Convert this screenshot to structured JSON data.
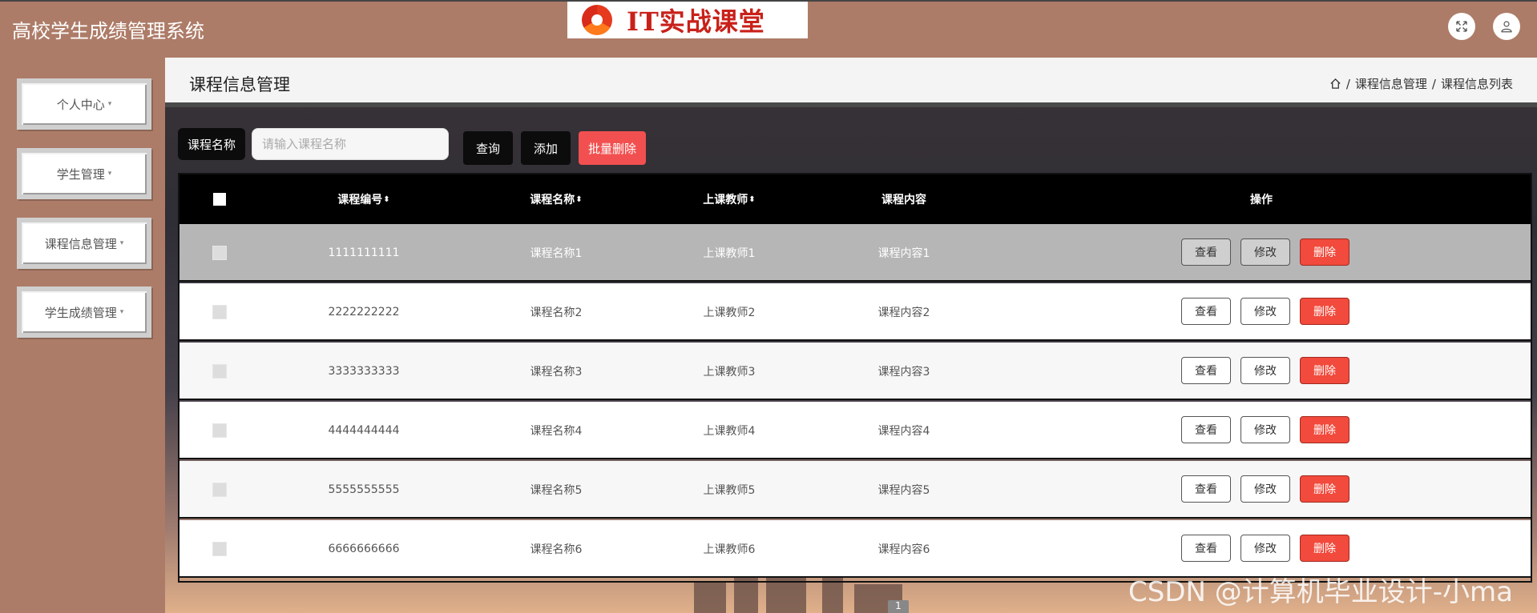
{
  "header": {
    "app_title": "高校学生成绩管理系统",
    "logo_text": "IT实战课堂",
    "fullscreen_icon": "fullscreen-icon",
    "user_icon": "user-icon"
  },
  "sidebar": {
    "items": [
      {
        "label": "个人中心"
      },
      {
        "label": "学生管理"
      },
      {
        "label": "课程信息管理"
      },
      {
        "label": "学生成绩管理"
      }
    ],
    "caret": "▾"
  },
  "page": {
    "title": "课程信息管理",
    "breadcrumb": [
      "课程信息管理",
      "课程信息列表"
    ],
    "separator": "/"
  },
  "search": {
    "label": "课程名称",
    "placeholder": "请输入课程名称",
    "query_button": "查询",
    "add_button": "添加",
    "batch_delete_button": "批量删除"
  },
  "table": {
    "columns": [
      "课程编号",
      "课程名称",
      "上课教师",
      "课程内容",
      "操作"
    ],
    "sort_glyph": "⬍",
    "actions": {
      "view": "查看",
      "edit": "修改",
      "delete": "删除"
    },
    "rows": [
      {
        "code": "1111111111",
        "name": "课程名称1",
        "teacher": "上课教师1",
        "content": "课程内容1",
        "hovered": true
      },
      {
        "code": "2222222222",
        "name": "课程名称2",
        "teacher": "上课教师2",
        "content": "课程内容2"
      },
      {
        "code": "3333333333",
        "name": "课程名称3",
        "teacher": "上课教师3",
        "content": "课程内容3"
      },
      {
        "code": "4444444444",
        "name": "课程名称4",
        "teacher": "上课教师4",
        "content": "课程内容4"
      },
      {
        "code": "5555555555",
        "name": "课程名称5",
        "teacher": "上课教师5",
        "content": "课程内容5"
      },
      {
        "code": "6666666666",
        "name": "课程名称6",
        "teacher": "上课教师6",
        "content": "课程内容6"
      }
    ]
  },
  "pagination": {
    "current": "1"
  },
  "watermark": "CSDN @计算机毕业设计-小ma",
  "colors": {
    "header_bg": "#ad7c68",
    "delete_red": "#f24a3c",
    "hover_row": "#b6b6b6"
  }
}
